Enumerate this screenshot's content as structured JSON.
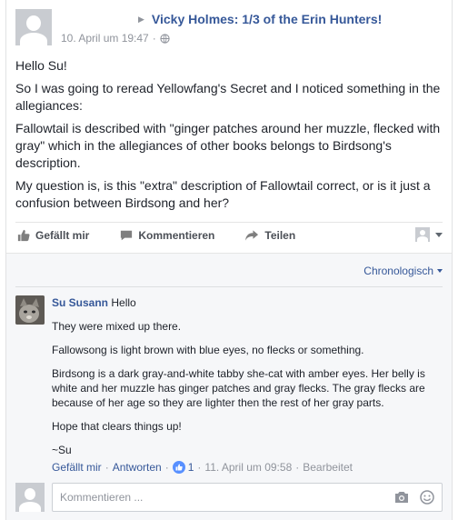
{
  "post": {
    "group_title": "Vicky Holmes: 1/3 of the Erin Hunters!",
    "timestamp": "10. April um 19:47",
    "paragraphs": [
      "Hello Su!",
      "So I was going to reread Yellowfang's Secret and I noticed something in the allegiances:",
      "Fallowtail is described with \"ginger patches around her muzzle, flecked with gray\" which in the allegiances of other books belongs to Birdsong's description.",
      "My question is, is this \"extra\" description of Fallowtail correct, or is it just a confusion between Birdsong and her?"
    ]
  },
  "actions": {
    "like": "Gefällt mir",
    "comment": "Kommentieren",
    "share": "Teilen"
  },
  "comments_sort": "Chronologisch",
  "comment": {
    "author": "Su Susann",
    "first_line": "Hello",
    "paragraphs": [
      "They were mixed up there.",
      "Fallowsong is light brown with blue eyes, no flecks or something.",
      "Birdsong is a dark gray-and-white tabby she-cat with amber eyes. Her belly is white and her muzzle has ginger patches and gray flecks. The gray flecks are because of her age so they are lighter then the rest of her gray parts.",
      "Hope that clears things up!",
      "~Su"
    ],
    "like_link": "Gefällt mir",
    "reply_link": "Antworten",
    "like_count": "1",
    "timestamp": "11. April um 09:58",
    "edited": "Bearbeitet"
  },
  "composer": {
    "placeholder": "Kommentieren ..."
  },
  "colors": {
    "link": "#365899",
    "text": "#1d2129",
    "muted": "#90949c",
    "like_blue": "#5890ff"
  },
  "icons": [
    "play-arrow-icon",
    "globe-icon",
    "thumbs-up-icon",
    "comment-bubble-icon",
    "share-arrow-icon",
    "camera-icon",
    "emoji-icon"
  ]
}
